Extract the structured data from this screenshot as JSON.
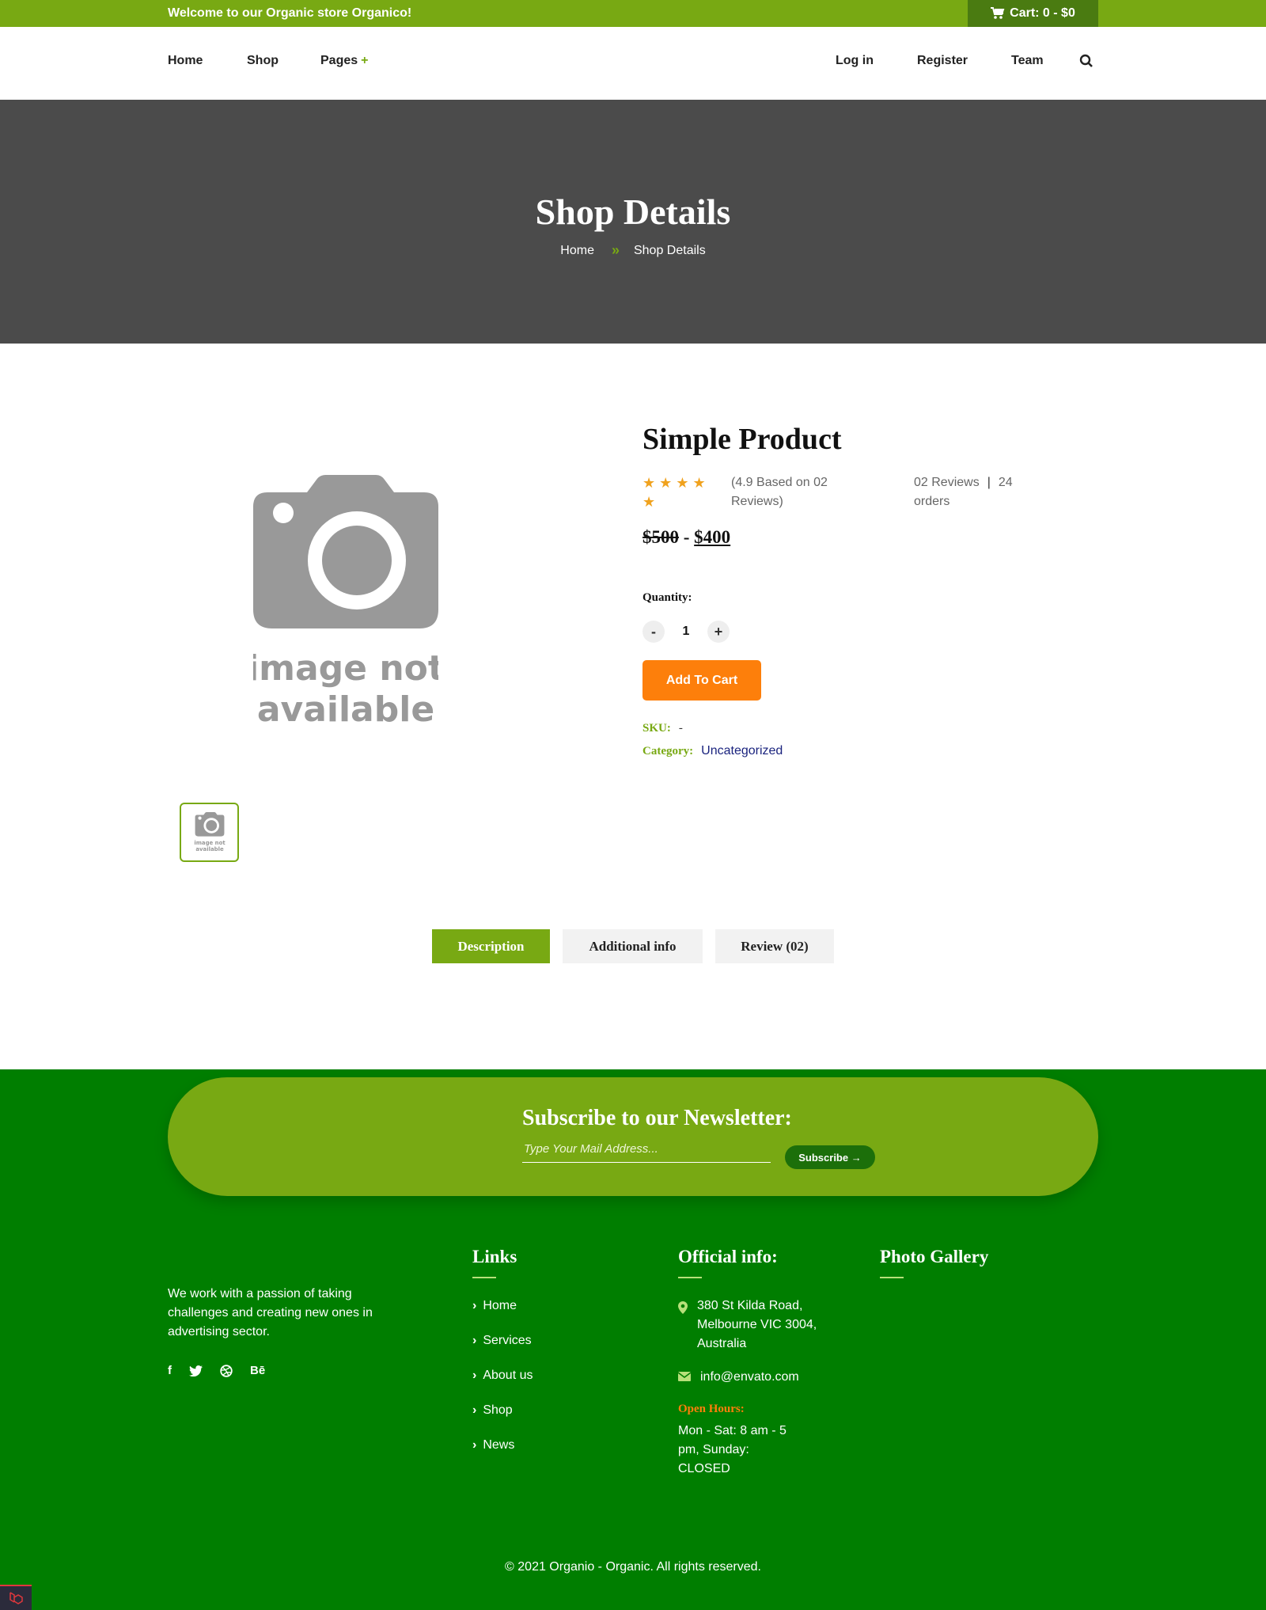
{
  "topbar": {
    "welcome": "Welcome to our Organic store Organico!",
    "cart_label": "Cart: 0 - $0"
  },
  "nav": {
    "left": [
      "Home",
      "Shop",
      "Pages"
    ],
    "pages_plus": "+",
    "right": [
      "Log in",
      "Register",
      "Team"
    ]
  },
  "banner": {
    "title": "Shop Details",
    "breadcrumb_home": "Home",
    "breadcrumb_separator": "»",
    "breadcrumb_current": "Shop Details"
  },
  "product": {
    "image_text_line1": "image not",
    "image_text_line2": "available",
    "thumb_text_line1": "image not",
    "thumb_text_line2": "available",
    "title": "Simple Product",
    "stars_filled": 5,
    "rating_text": "(4.9 Based on 02 Reviews)",
    "reviews": "02 Reviews",
    "reviews_separator": "|",
    "orders": "24 orders",
    "price_old": "$500",
    "price_separator": "-",
    "price_new": "$400",
    "quantity_label": "Quantity:",
    "qty_minus": "-",
    "qty_value": "1",
    "qty_plus": "+",
    "add_to_cart": "Add To Cart",
    "sku_label": "SKU:",
    "sku_value": "-",
    "category_label": "Category:",
    "category_value": "Uncategorized"
  },
  "tabs": [
    "Description",
    "Additional info",
    "Review (02)"
  ],
  "footer": {
    "newsletter_title": "Subscribe to our Newsletter:",
    "email_placeholder": "Type Your Mail Address...",
    "subscribe_label": "Subscribe",
    "subscribe_arrow": "→",
    "about": "We work with a passion of taking challenges and creating new ones in advertising sector.",
    "social": [
      "f",
      "behance"
    ],
    "social_labels": {
      "behance": "Bē"
    },
    "links_title": "Links",
    "links": [
      "Home",
      "Services",
      "About us",
      "Shop",
      "News"
    ],
    "official_title": "Official info:",
    "address": "380 St Kilda Road, Melbourne VIC 3004, Australia",
    "email": "info@envato.com",
    "hours_label": "Open Hours:",
    "hours": "Mon - Sat: 8 am - 5 pm, Sunday: CLOSED",
    "gallery_title": "Photo Gallery",
    "copyright": "© 2021 Organio - Organic. All rights reserved."
  },
  "colors": {
    "brand_green": "#78a913",
    "dark_green": "#007e00",
    "orange": "#fd7f0b",
    "banner_gray": "#4b4b4b"
  }
}
